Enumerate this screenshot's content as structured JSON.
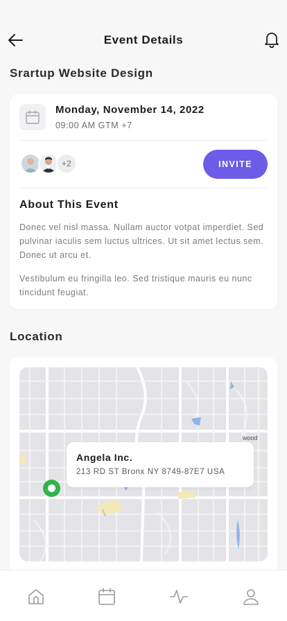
{
  "header": {
    "title": "Event Details",
    "back_icon": "arrow-left-icon",
    "bell_icon": "bell-icon"
  },
  "event": {
    "name": "Srartup Website Design",
    "date": "Monday, November 14, 2022",
    "time": "09:00 AM GTM +7",
    "calendar_icon": "calendar-icon",
    "attendees_more": "+2",
    "invite_label": "INVITE",
    "about_title": "About This Event",
    "about_paragraphs": [
      "Donec vel nisl massa. Nullam auctor votpat imperdiet. Sed pulvinar iaculis sem luctus ultrices. Ut sit amet lectus sem. Donec ut arcu et.",
      "Vestibulum eu fringilla leo. Sed tristique mauris eu nunc tincidunt feugiat."
    ]
  },
  "location": {
    "title": "Location",
    "place_name": "Angela Inc.",
    "address": "213 RD ST Bronx NY 8749-87E7 USA",
    "map_label": "wood"
  },
  "tabbar": {
    "items": [
      {
        "icon": "home-icon"
      },
      {
        "icon": "calendar-icon"
      },
      {
        "icon": "activity-icon"
      },
      {
        "icon": "profile-icon"
      }
    ]
  },
  "colors": {
    "accent": "#6c5ce7",
    "pin": "#2fb34a",
    "background": "#f7f7f8"
  }
}
